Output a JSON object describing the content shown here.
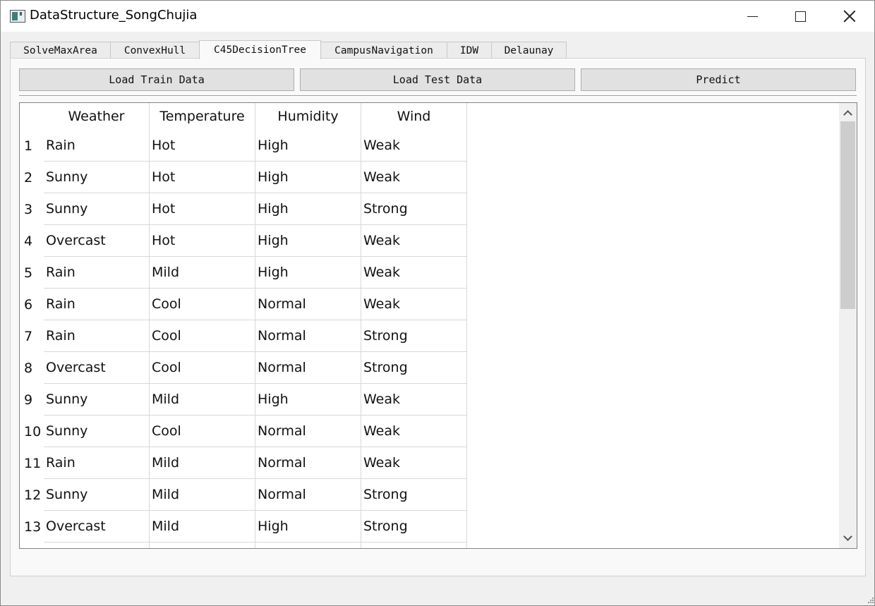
{
  "window": {
    "title": "DataStructure_SongChujia"
  },
  "tabs": [
    {
      "label": "SolveMaxArea"
    },
    {
      "label": "ConvexHull"
    },
    {
      "label": "C45DecisionTree"
    },
    {
      "label": "CampusNavigation"
    },
    {
      "label": "IDW"
    },
    {
      "label": "Delaunay"
    }
  ],
  "active_tab": "C45DecisionTree",
  "toolbar": {
    "load_train_label": "Load Train Data",
    "load_test_label": "Load Test Data",
    "predict_label": "Predict"
  },
  "table": {
    "columns": [
      "Weather",
      "Temperature",
      "Humidity",
      "Wind"
    ],
    "row_numbers": [
      "1",
      "2",
      "3",
      "4",
      "5",
      "6",
      "7",
      "8",
      "9",
      "10",
      "11",
      "12",
      "13"
    ],
    "rows": [
      [
        "Rain",
        "Hot",
        "High",
        "Weak"
      ],
      [
        "Sunny",
        "Hot",
        "High",
        "Weak"
      ],
      [
        "Sunny",
        "Hot",
        "High",
        "Strong"
      ],
      [
        "Overcast",
        "Hot",
        "High",
        "Weak"
      ],
      [
        "Rain",
        "Mild",
        "High",
        "Weak"
      ],
      [
        "Rain",
        "Cool",
        "Normal",
        "Weak"
      ],
      [
        "Rain",
        "Cool",
        "Normal",
        "Strong"
      ],
      [
        "Overcast",
        "Cool",
        "Normal",
        "Strong"
      ],
      [
        "Sunny",
        "Mild",
        "High",
        "Weak"
      ],
      [
        "Sunny",
        "Cool",
        "Normal",
        "Weak"
      ],
      [
        "Rain",
        "Mild",
        "Normal",
        "Weak"
      ],
      [
        "Sunny",
        "Mild",
        "Normal",
        "Strong"
      ],
      [
        "Overcast",
        "Mild",
        "High",
        "Strong"
      ]
    ]
  },
  "icons": {
    "app": "app-icon",
    "minimize": "minimize-icon",
    "maximize": "maximize-icon",
    "close": "close-icon",
    "scroll_up": "chevron-up-icon",
    "scroll_down": "chevron-down-icon"
  },
  "colors": {
    "background": "#f0f0f0",
    "panel": "#f9f9f9",
    "button": "#e1e1e1",
    "table_bg": "#ffffff",
    "grid": "#d8d8d8"
  }
}
